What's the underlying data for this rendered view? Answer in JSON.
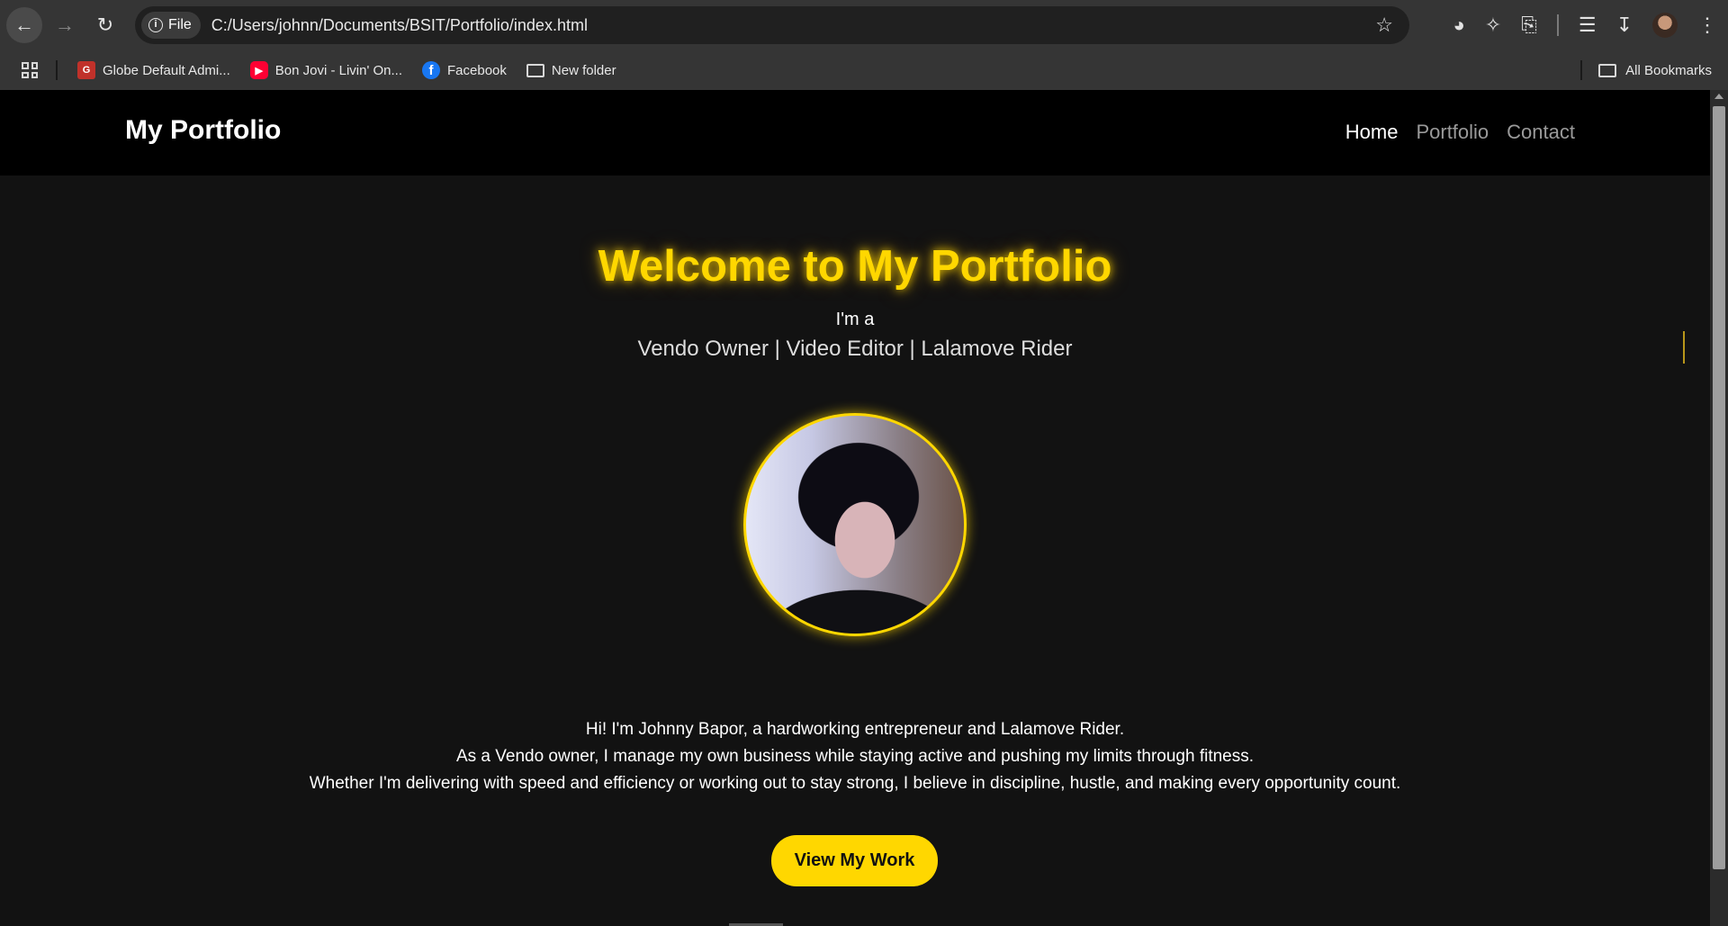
{
  "browser": {
    "back_icon": "arrow-left-icon",
    "forward_icon": "arrow-right-icon",
    "reload_icon": "reload-icon",
    "chip_label": "File",
    "url": "C:/Users/johnn/Documents/BSIT/Portfolio/index.html",
    "bookmarks": [
      {
        "label": "Globe Default Admi...",
        "icon": "globe-favicon"
      },
      {
        "label": "Bon Jovi - Livin' On...",
        "icon": "youtube-favicon"
      },
      {
        "label": "Facebook",
        "icon": "facebook-favicon"
      },
      {
        "label": "New folder",
        "icon": "folder-icon"
      }
    ],
    "all_bookmarks": "All Bookmarks"
  },
  "site": {
    "logo": "My Portfolio",
    "nav": [
      {
        "label": "Home",
        "active": true
      },
      {
        "label": "Portfolio",
        "active": false
      },
      {
        "label": "Contact",
        "active": false
      }
    ]
  },
  "hero": {
    "title": "Welcome to My Portfolio",
    "intro": "I'm a",
    "roles": "Vendo Owner | Video Editor | Lalamove Rider",
    "bio_lines": [
      "Hi! I'm Johnny Bapor, a hardworking entrepreneur and Lalamove Rider.",
      "As a Vendo owner, I manage my own business while staying active and pushing my limits through fitness.",
      "Whether I'm delivering with speed and efficiency or working out to stay strong, I believe in discipline, hustle, and making every opportunity count."
    ],
    "cta": "View My Work"
  },
  "colors": {
    "accent": "#ffd700",
    "background": "#121212",
    "header": "#000000"
  }
}
